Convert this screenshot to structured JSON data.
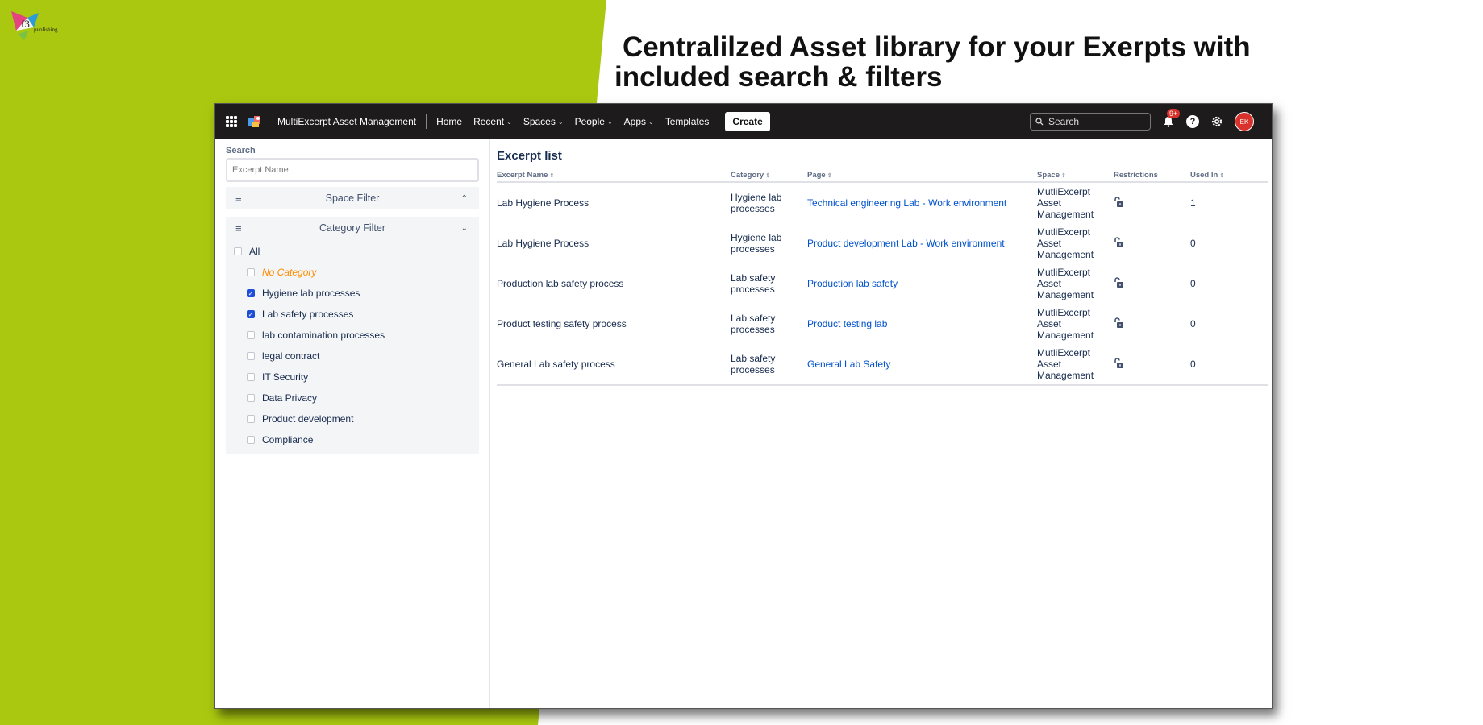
{
  "brand": {
    "logo_text": "publishing"
  },
  "headline": {
    "line1": "Centralilzed Asset library for your Exerpts with",
    "line2": "included search & filters"
  },
  "topbar": {
    "app_name": "MultiExcerpt Asset Management",
    "nav": [
      {
        "label": "Home",
        "dropdown": false
      },
      {
        "label": "Recent",
        "dropdown": true
      },
      {
        "label": "Spaces",
        "dropdown": true
      },
      {
        "label": "People",
        "dropdown": true
      },
      {
        "label": "Apps",
        "dropdown": true
      },
      {
        "label": "Templates",
        "dropdown": false
      }
    ],
    "create_label": "Create",
    "search_placeholder": "Search",
    "notification_badge": "9+",
    "avatar_initials": "EK"
  },
  "sidebar": {
    "search_label": "Search",
    "search_placeholder": "Excerpt Name",
    "space_filter_title": "Space Filter",
    "category_filter_title": "Category Filter",
    "categories": [
      {
        "label": "All",
        "checked": false
      },
      {
        "label": "No Category",
        "checked": false
      },
      {
        "label": "Hygiene lab processes",
        "checked": true
      },
      {
        "label": "Lab safety processes",
        "checked": true
      },
      {
        "label": "lab contamination processes",
        "checked": false
      },
      {
        "label": "legal contract",
        "checked": false
      },
      {
        "label": "IT Security",
        "checked": false
      },
      {
        "label": "Data Privacy",
        "checked": false
      },
      {
        "label": "Product development",
        "checked": false
      },
      {
        "label": "Compliance",
        "checked": false
      }
    ]
  },
  "main": {
    "title": "Excerpt list",
    "columns": [
      "Excerpt Name",
      "Category",
      "Page",
      "Space",
      "Restrictions",
      "Used In"
    ],
    "rows": [
      {
        "name": "Lab Hygiene Process",
        "category": [
          "Hygiene lab",
          "processes"
        ],
        "page": "Technical engineering Lab - Work environment",
        "space": [
          "MutliExcerpt",
          "Asset",
          "Management"
        ],
        "used_in": "1"
      },
      {
        "name": "Lab Hygiene Process",
        "category": [
          "Hygiene lab",
          "processes"
        ],
        "page": "Product development Lab - Work environment",
        "space": [
          "MutliExcerpt",
          "Asset",
          "Management"
        ],
        "used_in": "0"
      },
      {
        "name": "Production lab safety process",
        "category": [
          "Lab safety",
          "processes"
        ],
        "page": "Production lab safety",
        "space": [
          "MutliExcerpt",
          "Asset",
          "Management"
        ],
        "used_in": "0"
      },
      {
        "name": "Product testing safety process",
        "category": [
          "Lab safety",
          "processes"
        ],
        "page": "Product testing lab",
        "space": [
          "MutliExcerpt",
          "Asset",
          "Management"
        ],
        "used_in": "0"
      },
      {
        "name": "General Lab safety process",
        "category": [
          "Lab safety",
          "processes"
        ],
        "page": "General Lab Safety",
        "space": [
          "MutliExcerpt",
          "Asset",
          "Management"
        ],
        "used_in": "0"
      }
    ]
  },
  "colors": {
    "background_green": "#a9c80f",
    "topbar": "#1d1b1c",
    "link": "#0052cc",
    "accent_red": "#d9322c",
    "checkbox_blue": "#1f4fd8",
    "no_category_orange": "#ff8b00"
  }
}
